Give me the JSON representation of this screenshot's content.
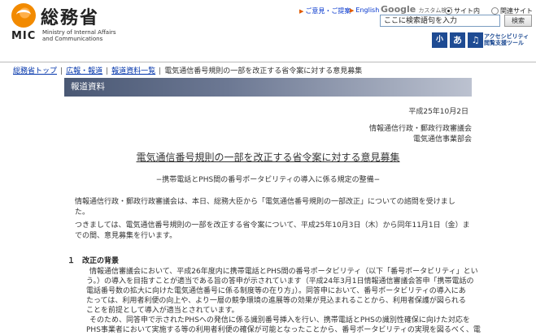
{
  "header": {
    "brand_kanji": "総務省",
    "brand_mic": "MIC",
    "brand_en_1": "Ministry of Internal Affairs",
    "brand_en_2": "and Communications",
    "links": [
      "ご意見・ご提案",
      "English"
    ],
    "google_label_g": "Google",
    "google_label_rest": "カスタム検索",
    "radio_site": "サイト内",
    "radio_related": "関連サイト",
    "search_value": "ここに検索語句を入力",
    "search_button": "検索",
    "font_small": "小",
    "font_large": "あ",
    "accessibility_1": "アクセシビリティ",
    "accessibility_2": "閲覧支援ツール"
  },
  "breadcrumb": [
    "総務省トップ",
    "広報・報道",
    "報道資料一覧",
    "電気通信番号規則の一部を改正する省令案に対する意見募集"
  ],
  "section_header": "報道資料",
  "date": "平成25年10月2日",
  "issuer_1": "情報通信行政・郵政行政審議会",
  "issuer_2": "電気通信事業部会",
  "title": "電気通信番号規則の一部を改正する省令案に対する意見募集",
  "subtitle": "−携帯電話とPHS間の番号ポータビリティの導入に係る規定の整備−",
  "para1_line1": "情報通信行政・郵政行政審議会は、本日、総務大臣から「電気通信番号規則の一部改正」についての諮問を受けまし",
  "para1_line2": "た。",
  "para2_line1": "つきましては、電気通信番号規則の一部を改正する省令案について、平成25年10月3日（木）から同年11月1日（金）ま",
  "para2_line2": "での間、意見募集を行います。",
  "section1_heading": "１　改正の背景",
  "section1_lines": [
    "情報通信審議会において、平成26年度内に携帯電話とPHS間の番号ポータビリティ（以下「番号ポータビリティ」とい",
    "う。）の導入を目指すことが適当である旨の答申が示されています（平成24年3月1日情報通信審議会答申「携帯電話の",
    "電話番号数の拡大に向けた電気通信番号に係る制度等の在り方」）。同答申において、番号ポータビリティの導入にあ",
    "たっては、利用者利便の向上や、より一層の競争環境の進展等の効果が見込まれることから、利用者保護が図られる",
    "ことを前提として導入が適当とされています。",
    "そのため、同答申で示されたPHSへの発信に係る識別番号挿入を行い、携帯電話とPHSの識別性確保に向けた対応を",
    "PHS事業者において実施する等の利用者利便の確保が可能となったことから、番号ポータビリティの実現を図るべく、電"
  ],
  "colors": {
    "accent_orange": "#f28a00",
    "link_blue": "#0033aa",
    "header_bar": "#5a6680"
  }
}
